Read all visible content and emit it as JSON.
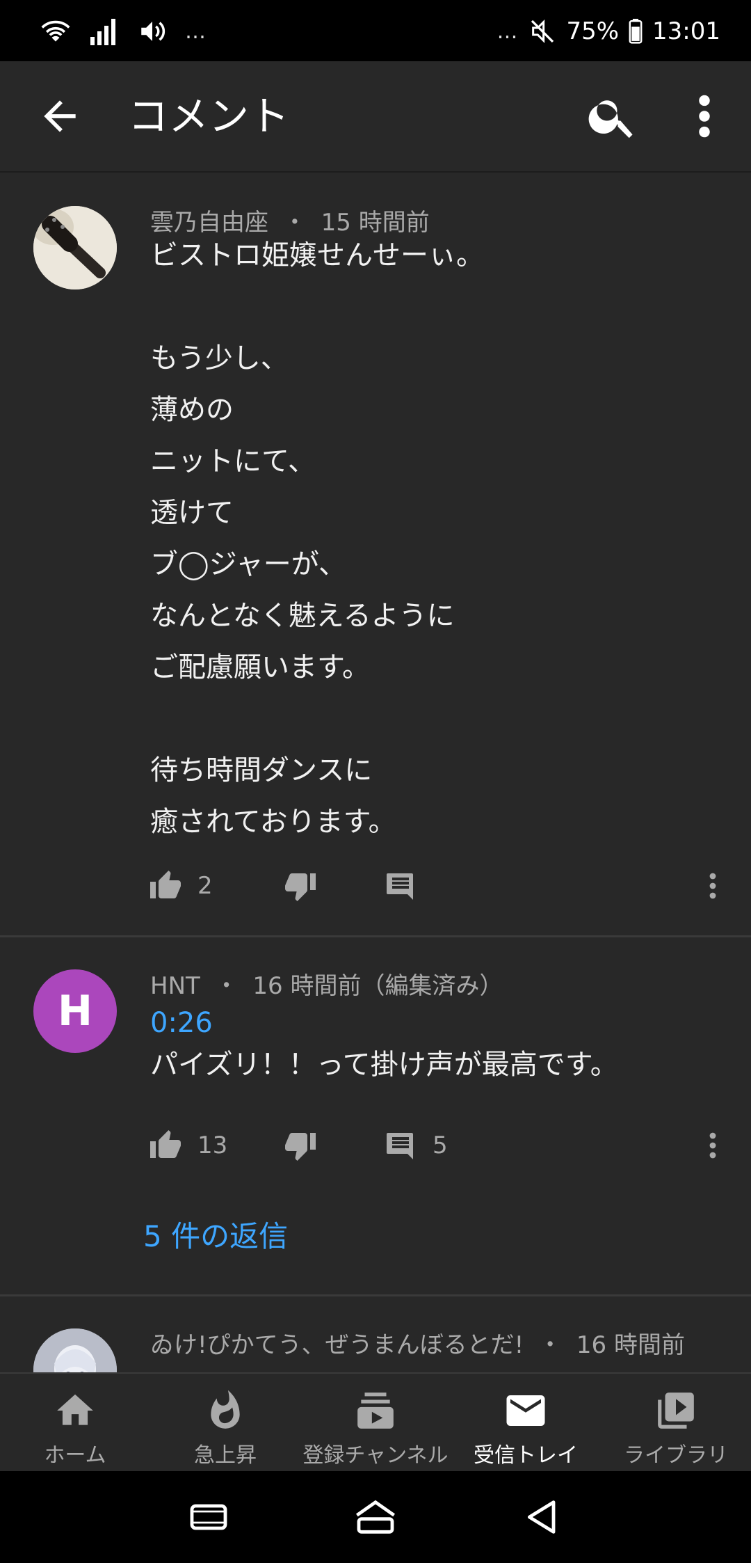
{
  "status_bar": {
    "left_dots": "…",
    "right_dots": "…",
    "battery": "75%",
    "time": "13:01"
  },
  "header": {
    "title": "コメント"
  },
  "comments": [
    {
      "author": "雲乃自由座",
      "time": "15 時間前",
      "text": "ビストロ姫嬢せんせーぃ。\n\nもう少し、\n薄めの\nニットにて、\n透けて\nブ◯ジャーが、\nなんとなく魅えるように\nご配慮願います。\n\n待ち時間ダンスに\n癒されております。",
      "likes": "2",
      "replies_count": ""
    },
    {
      "author": "HNT",
      "time": "16 時間前（編集済み）",
      "avatar_letter": "H",
      "avatar_color": "#ab47bc",
      "timestamp": "0:26",
      "text": "パイズリ！！って掛け声が最高です。",
      "likes": "13",
      "replies_count": "5",
      "view_replies": "5 件の返信"
    },
    {
      "author": "ゐけ!ぴかてう、ぜうまんぼるとだ!",
      "time": "16 時間前"
    }
  ],
  "meta_separator": "・",
  "bottom_nav": [
    {
      "label": "ホーム",
      "icon": "home-icon"
    },
    {
      "label": "急上昇",
      "icon": "trending-icon"
    },
    {
      "label": "登録チャンネル",
      "icon": "subscriptions-icon"
    },
    {
      "label": "受信トレイ",
      "icon": "inbox-icon",
      "active": true
    },
    {
      "label": "ライブラリ",
      "icon": "library-icon"
    }
  ],
  "colors": {
    "background": "#282828",
    "link": "#3ea6ff",
    "secondary_text": "#aaaaaa"
  }
}
